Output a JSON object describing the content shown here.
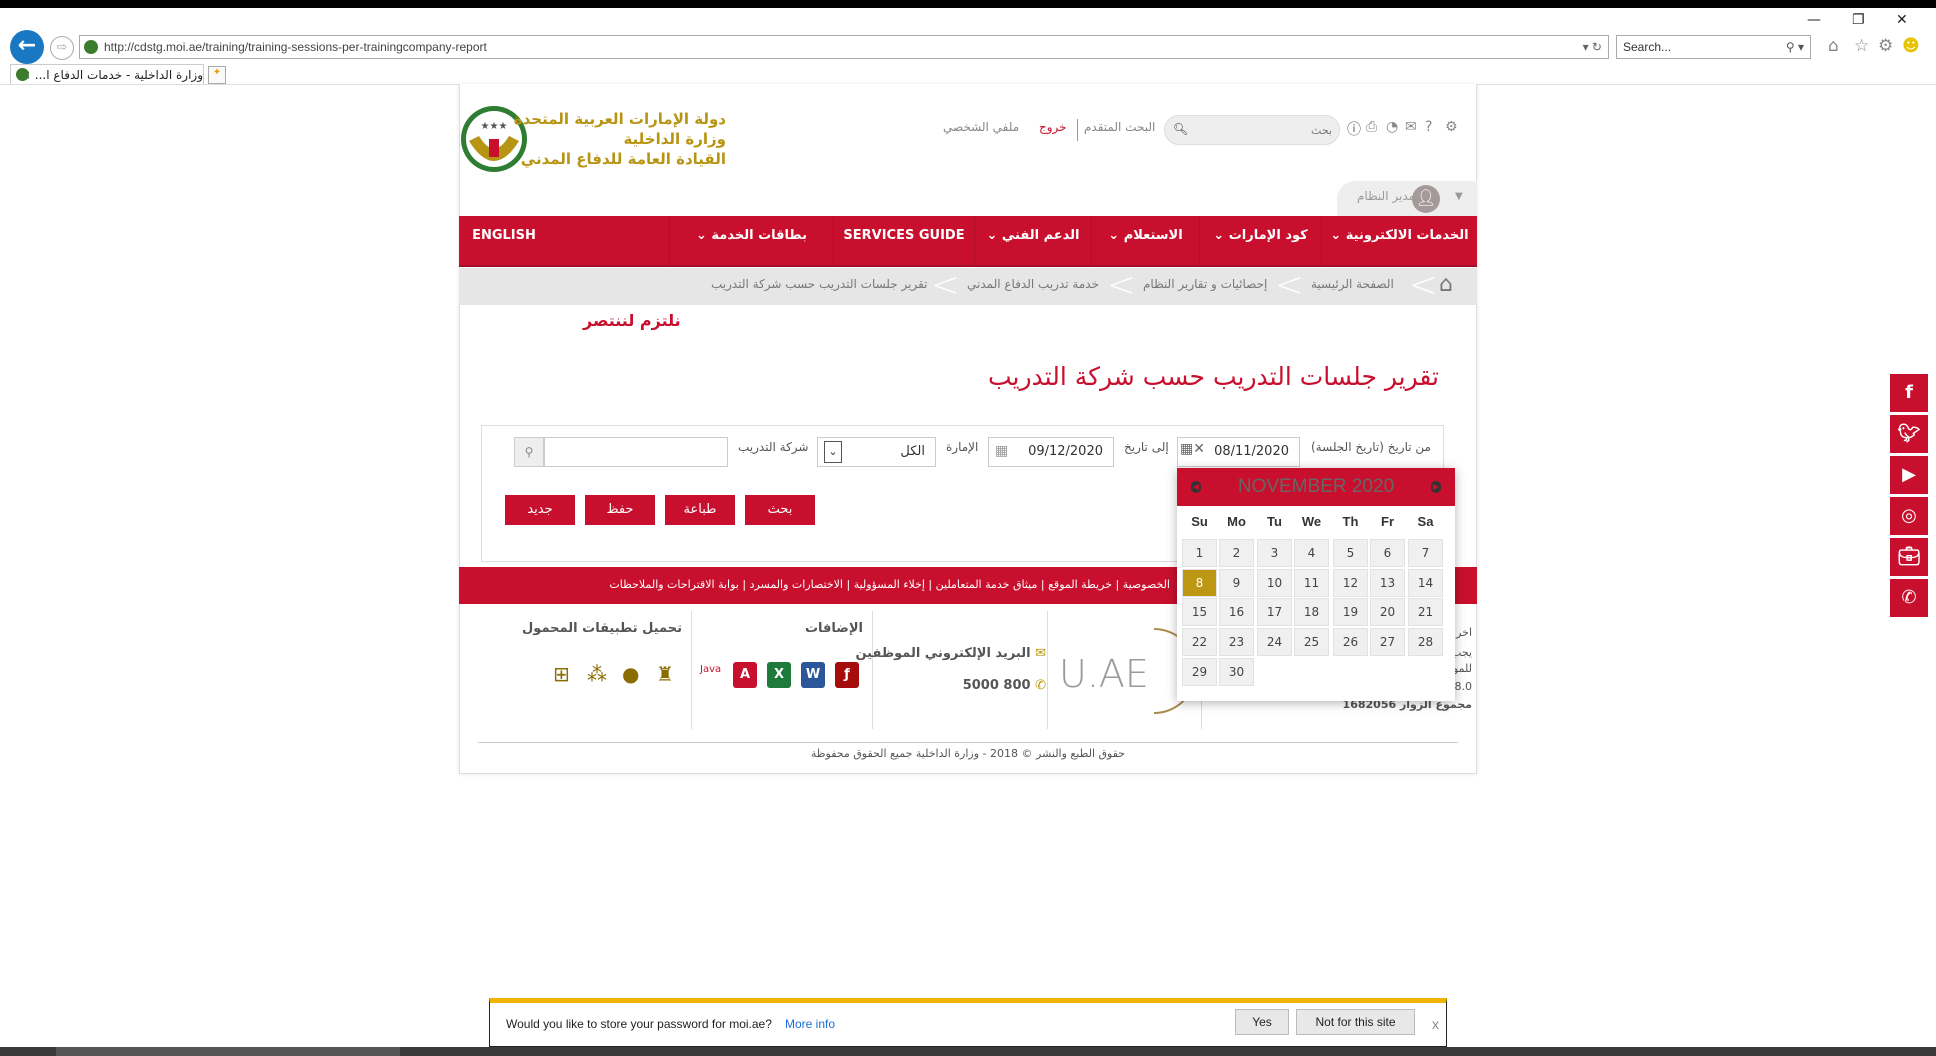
{
  "browser": {
    "url": "http://cdstg.moi.ae/training/training-sessions-per-trainingcompany-report",
    "search_placeholder": "Search...",
    "tab_title": "وزارة الداخلية - خدمات الدفاع ا...",
    "close_tab": "×"
  },
  "header": {
    "org_line1": "دولة الإمارات العربية المتحدة",
    "org_line2": "وزارة الداخلية",
    "org_line3": "القيادة العامة للدفاع المدني",
    "links": {
      "profile": "ملفي الشخصي",
      "logout": "خروج",
      "advanced_search": "البحث المتقدم"
    },
    "search_placeholder": "بحث",
    "user": "مدير النظام"
  },
  "nav": [
    {
      "label": "الخدمات الالكترونية",
      "dropdown": true
    },
    {
      "label": "كود الإمارات",
      "dropdown": true
    },
    {
      "label": "الاستعلام",
      "dropdown": true
    },
    {
      "label": "الدعم الفني",
      "dropdown": true
    },
    {
      "label": "SERVICES GUIDE",
      "dropdown": false
    },
    {
      "label": "بطاقات الخدمة",
      "dropdown": true
    },
    {
      "label": "ENGLISH",
      "dropdown": false
    }
  ],
  "breadcrumb": [
    "الصفحة الرئيسية",
    "إحصائيات و تقارير النظام",
    "خدمة تدريب الدفاع المدني",
    "تقرير جلسات التدريب حسب شركة التدريب"
  ],
  "slogan": "نلتزم لننتصر",
  "page_title": "تقرير جلسات التدريب حسب شركة التدريب",
  "filters": {
    "from_label": "من تاريخ (تاريخ الجلسة)",
    "from_value": "08/11/2020",
    "to_label": "إلى تاريخ",
    "to_value": "09/12/2020",
    "emirate_label": "الإمارة",
    "emirate_value": "الكل",
    "company_label": "شركة التدريب",
    "company_value": ""
  },
  "buttons": {
    "search": "بحث",
    "print": "طباعة",
    "save": "حفظ",
    "new": "جديد"
  },
  "calendar": {
    "month": "NOVEMBER 2020",
    "weekdays": [
      "Su",
      "Mo",
      "Tu",
      "We",
      "Th",
      "Fr",
      "Sa"
    ],
    "days": [
      "1",
      "2",
      "3",
      "4",
      "5",
      "6",
      "7",
      "8",
      "9",
      "10",
      "11",
      "12",
      "13",
      "14",
      "15",
      "16",
      "17",
      "18",
      "19",
      "20",
      "21",
      "22",
      "23",
      "24",
      "25",
      "26",
      "27",
      "28",
      "29",
      "30"
    ],
    "selected": "8",
    "first_weekday_index": 0
  },
  "footer": {
    "links": [
      "الخصوصية",
      "خريطة الموقع",
      "ميثاق خدمة المتعاملين",
      "إخلاء المسؤولية",
      "الاختصارات والمسرد",
      "بوابة الاقتراحات والملاحظات"
    ],
    "apps_title": "تحميل تطبيقات المحمول",
    "addons_title": "الإضافات",
    "java": "Java",
    "email_title": "البريد الإلكتروني الموظفين",
    "phone": "800 5000",
    "uae_logo": "U.AE",
    "info_fragments": [
      "اخر ت",
      "يجب",
      "للمو",
      "8.0"
    ],
    "visitors": "مجموع الزوار 1682056",
    "copyright": "حقوق الطبع والنشر © 2018 - وزارة الداخلية جميع الحقوق محفوظة"
  },
  "social": [
    "facebook-icon",
    "twitter-icon",
    "youtube-icon",
    "instagram-icon",
    "briefcase-icon",
    "phone-icon"
  ],
  "password_bar": {
    "text": "Would you like to store your password for moi.ae?",
    "more": "More info",
    "yes": "Yes",
    "no": "Not for this site",
    "close": "x"
  },
  "colors": {
    "brand_red": "#c8102e",
    "gold": "#b89413",
    "selected_day": "#bd9614",
    "ie_blue": "#1a78c2"
  }
}
